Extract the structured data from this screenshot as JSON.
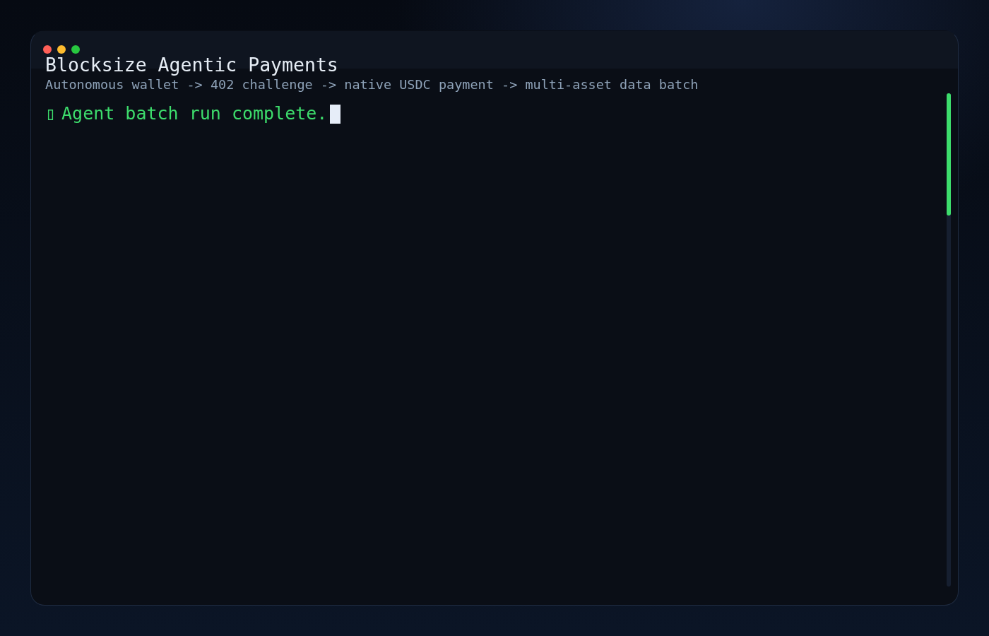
{
  "window": {
    "title": "Blocksize Agentic Payments",
    "subtitle": "Autonomous wallet -> 402 challenge -> native USDC payment -> multi-asset data batch"
  },
  "terminal": {
    "lines": [
      {
        "icon": "▯",
        "text": "Agent batch run complete.",
        "cursor": true
      }
    ]
  }
}
